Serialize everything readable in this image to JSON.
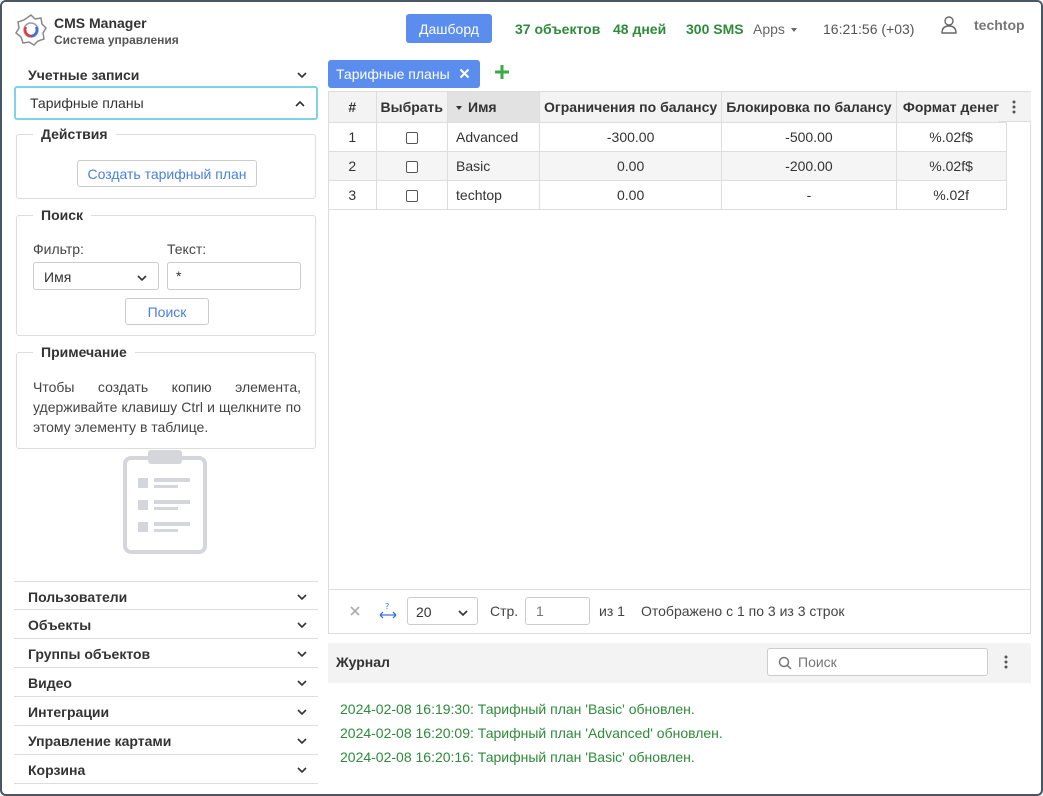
{
  "header": {
    "title": "CMS Manager",
    "subtitle": "Система управления",
    "dashboard_label": "Дашборд",
    "objects": "37 объектов",
    "days": "48 дней",
    "sms": "300 SMS",
    "apps": "Apps",
    "clock": "16:21:56 (+03)",
    "user": "techtop"
  },
  "sidebar": {
    "top_items": [
      {
        "label": "Учетные записи"
      },
      {
        "label": "Тарифные планы"
      }
    ],
    "actions": {
      "legend": "Действия",
      "create_label": "Создать тарифный план"
    },
    "search": {
      "legend": "Поиск",
      "filter_label": "Фильтр:",
      "filter_value": "Имя",
      "text_label": "Текст:",
      "text_value": "*",
      "button": "Поиск"
    },
    "note": {
      "legend": "Примечание",
      "text": "Чтобы создать копию элемента, удерживайте клавишу Ctrl и щелкните по этому элементу в таблице."
    },
    "bottom_items": [
      {
        "label": "Пользователи"
      },
      {
        "label": "Объекты"
      },
      {
        "label": "Группы объектов"
      },
      {
        "label": "Видео"
      },
      {
        "label": "Интеграции"
      },
      {
        "label": "Управление картами"
      },
      {
        "label": "Корзина"
      }
    ]
  },
  "tab": {
    "label": "Тарифные планы"
  },
  "table": {
    "columns": [
      "#",
      "Выбрать",
      "Имя",
      "Ограничения по балансу",
      "Блокировка по балансу",
      "Формат денег"
    ],
    "rows": [
      {
        "n": "1",
        "name": "Advanced",
        "limit": "-300.00",
        "block": "-500.00",
        "format": "%.02f$"
      },
      {
        "n": "2",
        "name": "Basic",
        "limit": "0.00",
        "block": "-200.00",
        "format": "%.02f$"
      },
      {
        "n": "3",
        "name": "techtop",
        "limit": "0.00",
        "block": "-",
        "format": "%.02f"
      }
    ]
  },
  "pager": {
    "page_size": "20",
    "page_label": "Стр.",
    "page_placeholder": "1",
    "of": "из 1",
    "summary": "Отображено с 1 по 3 из 3 строк"
  },
  "log": {
    "title": "Журнал",
    "search_placeholder": "Поиск",
    "entries": [
      "2024-02-08 16:19:30: Тарифный план 'Basic' обновлен.",
      "2024-02-08 16:20:09: Тарифный план 'Advanced' обновлен.",
      "2024-02-08 16:20:16: Тарифный план 'Basic' обновлен."
    ]
  },
  "colors": {
    "accent": "#5b8def",
    "success": "#2e8b3a",
    "active_border": "#7dd3e8"
  }
}
